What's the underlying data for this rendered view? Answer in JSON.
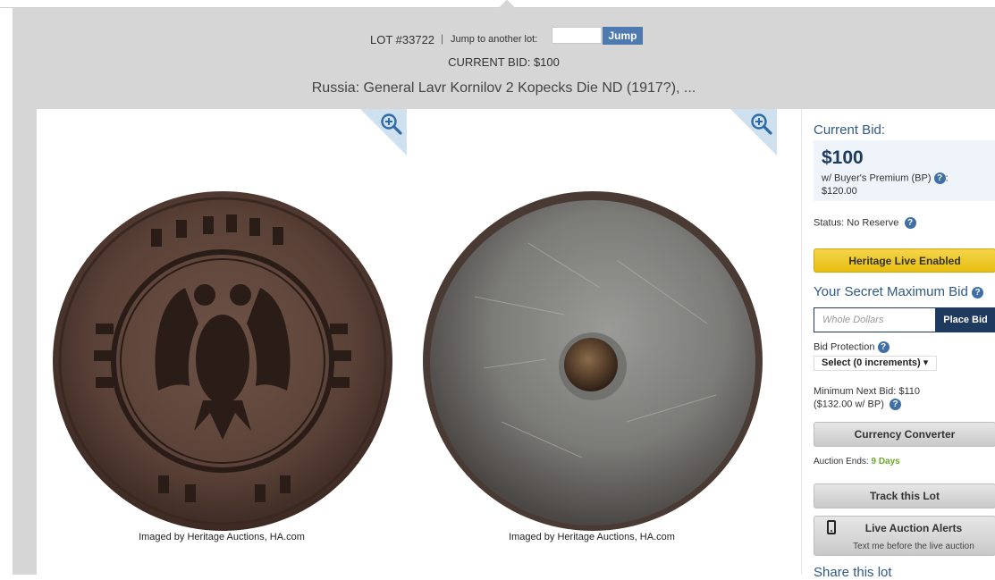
{
  "header": {
    "lot_number": "LOT #33722",
    "separator": "|",
    "jump_label": "Jump to another lot:",
    "jump_input_value": "",
    "jump_button": "Jump",
    "current_bid_text": "CURRENT BID: $100",
    "title": "Russia: General Lavr Kornilov 2 Kopecks Die ND (1917?), ..."
  },
  "images": [
    {
      "caption": "Imaged by Heritage Auctions, HA.com",
      "icon": "zoom-in-icon"
    },
    {
      "caption": "Imaged by Heritage Auctions, HA.com",
      "icon": "zoom-in-icon"
    }
  ],
  "sidebar": {
    "current_bid_label": "Current Bid:",
    "current_bid_value": "$100",
    "bp_line1": "w/ Buyer's Premium (BP)",
    "bp_colon": ":",
    "bp_value": "$120.00",
    "status": "Status: No Reserve",
    "live_button": "Heritage Live Enabled",
    "secret_max_label": "Your Secret Maximum Bid",
    "bid_placeholder": "Whole Dollars",
    "place_bid": "Place Bid",
    "bid_protection": "Bid Protection",
    "select_value": "Select (0 increments) ▾",
    "min_next_1": "Minimum Next Bid: $110",
    "min_next_2": "($132.00 w/ BP)",
    "currency_button": "Currency Converter",
    "auction_ends_label": "Auction Ends:",
    "auction_ends_value": "9 Days",
    "track_button": "Track this Lot",
    "alerts_title": "Live Auction Alerts",
    "alerts_sub": "Text me before the live auction",
    "share": "Share this lot",
    "help_glyph": "?"
  },
  "colors": {
    "overlay_bg": "#d6d6d6",
    "brand_navy": "#1e3a5f",
    "link_blue": "#2f5a86",
    "gold": "#e8be0f",
    "days_green": "#6aaa2a"
  }
}
